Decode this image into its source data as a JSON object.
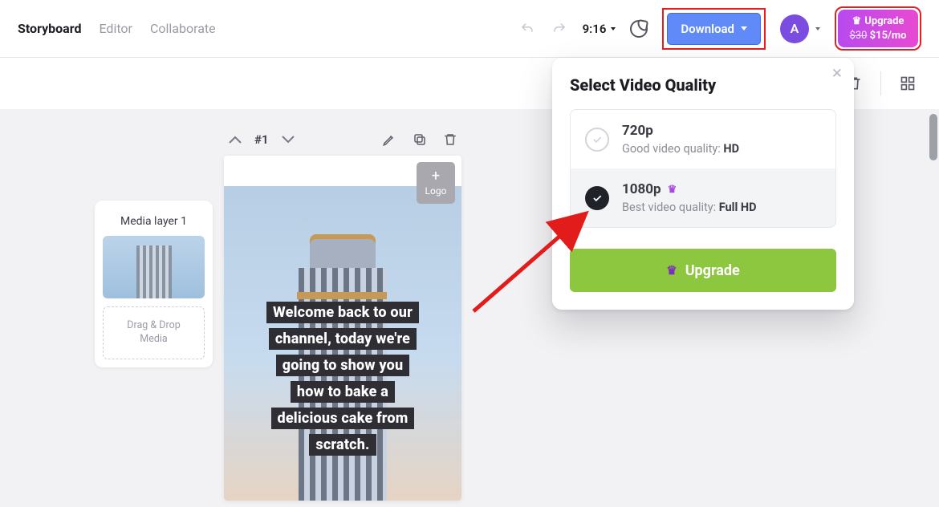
{
  "nav": {
    "storyboard": "Storyboard",
    "editor": "Editor",
    "collaborate": "Collaborate"
  },
  "topbar": {
    "time": "9:16",
    "download": "Download",
    "avatar_letter": "A",
    "upgrade_label": "Upgrade",
    "price_old": "$30",
    "price_new": "$15/mo"
  },
  "popover": {
    "title": "Select Video Quality",
    "opt720": {
      "title": "720p",
      "subtitle": "Good video quality: ",
      "tag": "HD"
    },
    "opt1080": {
      "title": "1080p",
      "subtitle": "Best video quality: ",
      "tag": "Full HD"
    },
    "upgrade": "Upgrade"
  },
  "media": {
    "layer_title": "Media layer 1",
    "drop_l1": "Drag & Drop",
    "drop_l2": "Media"
  },
  "scene": {
    "number": "#1",
    "logo_label": "Logo",
    "caption_lines": [
      "Welcome back to our",
      "channel, today we're",
      "going to show you",
      "how to bake a",
      "delicious cake from",
      "scratch."
    ]
  }
}
